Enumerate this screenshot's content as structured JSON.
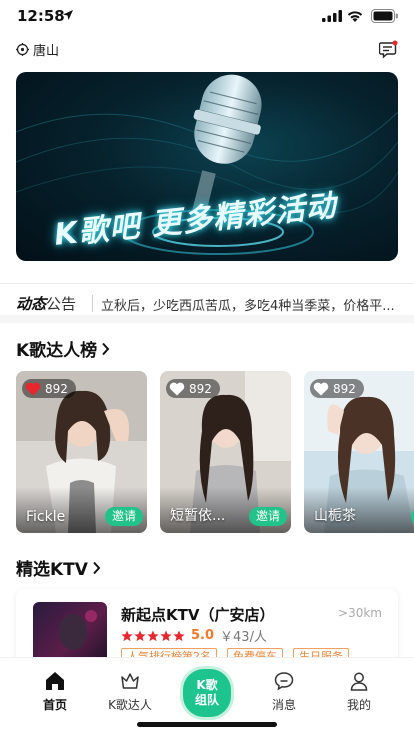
{
  "status_bar": {
    "time": "12:58"
  },
  "header": {
    "location": "唐山"
  },
  "banner": {
    "title": "K歌吧 更多精彩活动"
  },
  "news": {
    "label_bold": "动态",
    "label_rest": "公告",
    "text": "立秋后，少吃西瓜苦瓜，多吃4种当季菜，价格平..."
  },
  "talent_section": {
    "title": "K歌达人榜",
    "cards": [
      {
        "name": "Fickle",
        "likes": "892",
        "invite": "邀请",
        "liked": true
      },
      {
        "name": "短暂依...",
        "likes": "892",
        "invite": "邀请",
        "liked": false
      },
      {
        "name": "山栀茶",
        "likes": "892",
        "invite": "邀请",
        "liked": false
      }
    ]
  },
  "ktv_section": {
    "title": "精选KTV",
    "item": {
      "name": "新起点KTV（广安店）",
      "distance": ">30km",
      "rating": "5.0",
      "stars": 5,
      "price": "￥43/人",
      "tags": [
        "人气排行榜第2名",
        "免费停车",
        "生日服务"
      ]
    }
  },
  "tab_bar": {
    "home": "首页",
    "talent": "K歌达人",
    "center_line1": "K歌",
    "center_line2": "组队",
    "messages": "消息",
    "mine": "我的"
  },
  "colors": {
    "accent": "#1ec48e",
    "like_red": "#e8262e",
    "rating_orange": "#f07a2a"
  }
}
